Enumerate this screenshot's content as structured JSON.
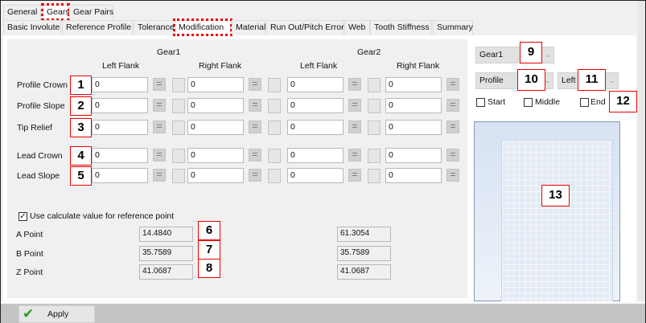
{
  "top_tabs": [
    {
      "label": "General"
    },
    {
      "label": "Gears"
    },
    {
      "label": "Gear Pairs"
    }
  ],
  "sub_tabs": [
    {
      "label": "Basic Involute"
    },
    {
      "label": "Reference Profile"
    },
    {
      "label": "Tolerance"
    },
    {
      "label": "Modification"
    },
    {
      "label": "Material"
    },
    {
      "label": "Run Out/Pitch Error"
    },
    {
      "label": "Web"
    },
    {
      "label": "Tooth Stiffness"
    },
    {
      "label": "Summary"
    }
  ],
  "gear1_label": "Gear1",
  "gear2_label": "Gear2",
  "left_flank": "Left Flank",
  "right_flank": "Right Flank",
  "eq_symbol": "=",
  "rows": [
    {
      "label": "Profile Crown",
      "marker": "1",
      "g1_left": "0",
      "g1_right": "0",
      "g2_left": "0",
      "g2_right": "0"
    },
    {
      "label": "Profile Slope",
      "marker": "2",
      "g1_left": "0",
      "g1_right": "0",
      "g2_left": "0",
      "g2_right": "0"
    },
    {
      "label": "Tip Relief",
      "marker": "3",
      "g1_left": "0",
      "g1_right": "0",
      "g2_left": "0",
      "g2_right": "0"
    },
    {
      "label": "Lead Crown",
      "marker": "4",
      "g1_left": "0",
      "g1_right": "0",
      "g2_left": "0",
      "g2_right": "0"
    },
    {
      "label": "Lead Slope",
      "marker": "5",
      "g1_left": "0",
      "g1_right": "0",
      "g2_left": "0",
      "g2_right": "0"
    }
  ],
  "use_calc": {
    "label": "Use calculate value for reference point",
    "checked": true,
    "check": "✓"
  },
  "points": [
    {
      "label": "A Point",
      "marker": "6",
      "gear1": "14.4840",
      "gear2": "61.3054"
    },
    {
      "label": "B Point",
      "marker": "7",
      "gear1": "35.7589",
      "gear2": "35.7589"
    },
    {
      "label": "Z Point",
      "marker": "8",
      "gear1": "41.0687",
      "gear2": "41.0687"
    }
  ],
  "right": {
    "gear_select": "Gear1",
    "gear_marker": "9",
    "type_select": "Profile",
    "type_marker": "10",
    "flank_select": "Left",
    "flank_marker": "11",
    "start": "Start",
    "middle": "Middle",
    "end": "End",
    "check_marker": "12",
    "preview_marker": "13"
  },
  "arrow": "⌄",
  "apply": "Apply",
  "apply_icon": "✔",
  "colors": {
    "annotation": "#e00000",
    "check_green": "#2a9d2a"
  }
}
